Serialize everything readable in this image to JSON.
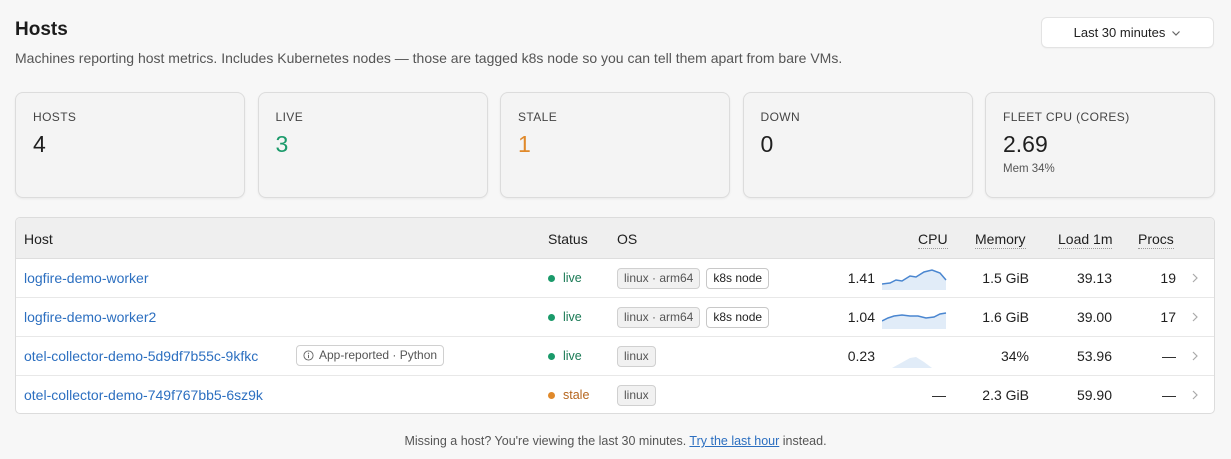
{
  "header": {
    "title": "Hosts",
    "subtitle": "Machines reporting host metrics. Includes Kubernetes nodes — those are tagged k8s node so you can tell them apart from bare VMs.",
    "time_range": "Last 30 minutes"
  },
  "stats": [
    {
      "label": "HOSTS",
      "value": "4",
      "color": "#1f1f1f"
    },
    {
      "label": "LIVE",
      "value": "3",
      "color": "#1a9a6a"
    },
    {
      "label": "STALE",
      "value": "1",
      "color": "#e0892a"
    },
    {
      "label": "DOWN",
      "value": "0",
      "color": "#1f1f1f"
    },
    {
      "label": "FLEET CPU (CORES)",
      "value": "2.69",
      "sub": "Mem 34%",
      "color": "#1f1f1f"
    }
  ],
  "table": {
    "columns": {
      "host": "Host",
      "status": "Status",
      "os": "OS",
      "cpu": "CPU",
      "memory": "Memory",
      "load": "Load 1m",
      "procs": "Procs"
    },
    "rows": [
      {
        "host": "logfire-demo-worker",
        "status": "live",
        "os": "linux · arm64",
        "k8s": "k8s node",
        "cpu": "1.41",
        "memory": "1.5 GiB",
        "load": "39.13",
        "procs": "19"
      },
      {
        "host": "logfire-demo-worker2",
        "status": "live",
        "os": "linux · arm64",
        "k8s": "k8s node",
        "cpu": "1.04",
        "memory": "1.6 GiB",
        "load": "39.00",
        "procs": "17"
      },
      {
        "host": "otel-collector-demo-5d9df7b55c-9kfkc",
        "app_badge": "App-reported · Python",
        "status": "live",
        "os": "linux",
        "cpu": "0.23",
        "memory": "34%",
        "load": "53.96",
        "procs": "—"
      },
      {
        "host": "otel-collector-demo-749f767bb5-6sz9k",
        "status": "stale",
        "os": "linux",
        "cpu": "—",
        "memory": "2.3 GiB",
        "load": "59.90",
        "procs": "—"
      }
    ]
  },
  "colors": {
    "live": "#1a9a6a",
    "stale": "#e0892a",
    "link": "#2c6fc0",
    "stale_text": "#b5651d"
  },
  "footer": {
    "text_before": "Missing a host? You're viewing the last 30 minutes.",
    "link": "Try the last hour",
    "text_after": "instead."
  }
}
